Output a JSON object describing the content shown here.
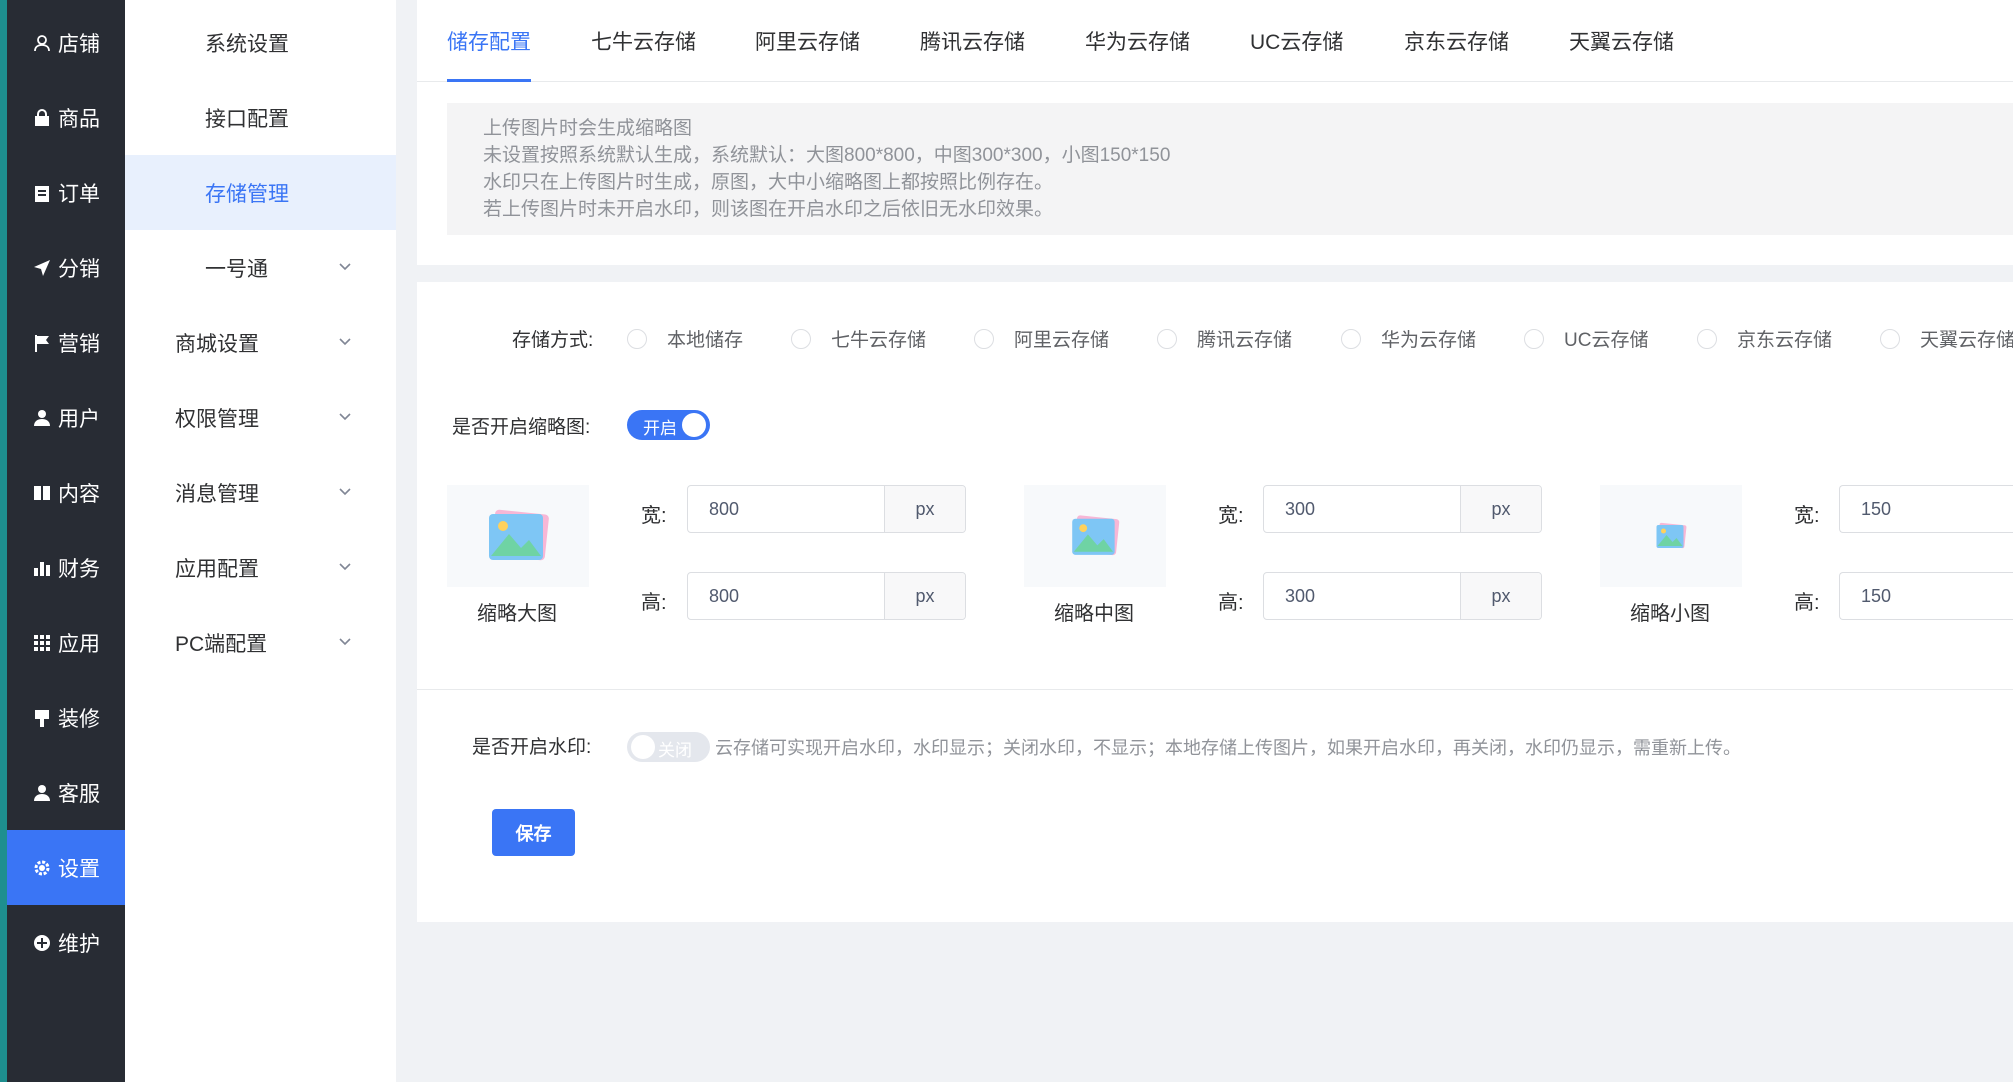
{
  "nav_primary": [
    {
      "label": "店铺",
      "icon": "store-icon"
    },
    {
      "label": "商品",
      "icon": "bag-icon"
    },
    {
      "label": "订单",
      "icon": "clipboard-icon"
    },
    {
      "label": "分销",
      "icon": "send-icon"
    },
    {
      "label": "营销",
      "icon": "flag-icon"
    },
    {
      "label": "用户",
      "icon": "user-icon"
    },
    {
      "label": "内容",
      "icon": "book-icon"
    },
    {
      "label": "财务",
      "icon": "bar-chart-icon"
    },
    {
      "label": "应用",
      "icon": "grid-icon"
    },
    {
      "label": "装修",
      "icon": "brush-icon"
    },
    {
      "label": "客服",
      "icon": "headset-icon"
    },
    {
      "label": "设置",
      "icon": "gear-icon",
      "active": true
    },
    {
      "label": "维护",
      "icon": "plus-circle-icon"
    }
  ],
  "nav_secondary": [
    {
      "label": "系统设置"
    },
    {
      "label": "接口配置"
    },
    {
      "label": "存储管理",
      "active": true
    },
    {
      "label": "一号通",
      "expandable": true
    },
    {
      "label": "商城设置",
      "expandable": true
    },
    {
      "label": "权限管理",
      "expandable": true
    },
    {
      "label": "消息管理",
      "expandable": true
    },
    {
      "label": "应用配置",
      "expandable": true
    },
    {
      "label": "PC端配置",
      "expandable": true
    }
  ],
  "tabs": [
    "储存配置",
    "七牛云存储",
    "阿里云存储",
    "腾讯云存储",
    "华为云存储",
    "UC云存储",
    "京东云存储",
    "天翼云存储"
  ],
  "active_tab": 0,
  "notice": [
    "上传图片时会生成缩略图",
    "未设置按照系统默认生成，系统默认：大图800*800，中图300*300，小图150*150",
    "水印只在上传图片时生成，原图，大中小缩略图上都按照比例存在。",
    "若上传图片时未开启水印，则该图在开启水印之后依旧无水印效果。"
  ],
  "storage": {
    "label": "存储方式:",
    "options": [
      "本地储存",
      "七牛云存储",
      "阿里云存储",
      "腾讯云存储",
      "华为云存储",
      "UC云存储",
      "京东云存储",
      "天翼云存储"
    ]
  },
  "thumbnail": {
    "label": "是否开启缩略图:",
    "switch_text": "开启",
    "enabled": true,
    "width_label": "宽:",
    "height_label": "高:",
    "unit": "px",
    "sizes": [
      {
        "name": "缩略大图",
        "width": "800",
        "height": "800"
      },
      {
        "name": "缩略中图",
        "width": "300",
        "height": "300"
      },
      {
        "name": "缩略小图",
        "width": "150",
        "height": "150"
      }
    ]
  },
  "watermark": {
    "label": "是否开启水印:",
    "switch_text": "关闭",
    "enabled": false,
    "hint": "云存储可实现开启水印，水印显示；关闭水印，不显示；本地存储上传图片，如果开启水印，再关闭，水印仍显示，需重新上传。"
  },
  "save_label": "保存",
  "colors": {
    "primary": "#3a75f5",
    "sidebar": "#282c34"
  }
}
